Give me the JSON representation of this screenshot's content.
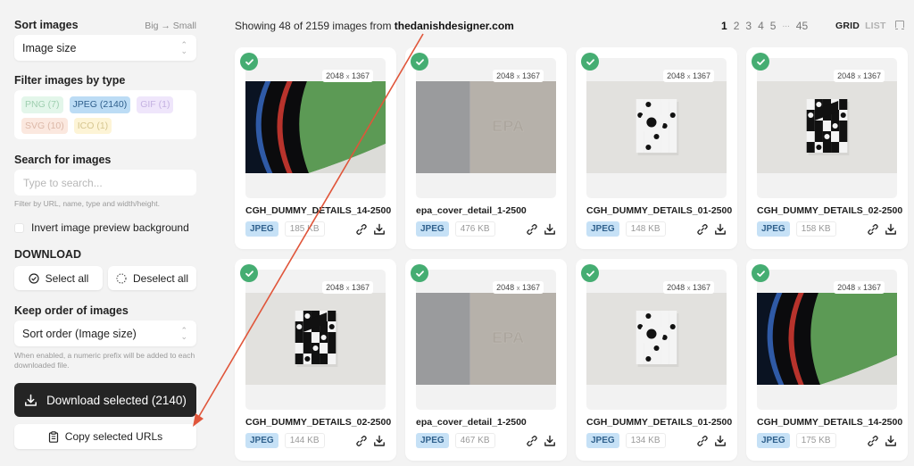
{
  "sidebar": {
    "sort": {
      "title": "Sort images",
      "hint": "Big → Small",
      "selected": "Image size"
    },
    "filter": {
      "title": "Filter images by type",
      "chips": [
        {
          "label": "PNG (7)",
          "bg": "#e3f6ea",
          "fg": "#9fcfb0"
        },
        {
          "label": "JPEG (2140)",
          "bg": "#bcdcf5",
          "fg": "#2f5f8c"
        },
        {
          "label": "GIF (1)",
          "bg": "#efe6fb",
          "fg": "#c4b2e2"
        },
        {
          "label": "SVG (10)",
          "bg": "#fbe8df",
          "fg": "#dcb8a8"
        },
        {
          "label": "ICO (1)",
          "bg": "#fdf4d6",
          "fg": "#d6c690"
        }
      ]
    },
    "search": {
      "title": "Search for images",
      "placeholder": "Type to search...",
      "value": "",
      "help": "Filter by URL, name, type and width/height."
    },
    "invert": {
      "label": "Invert image preview background",
      "checked": false
    },
    "download": {
      "title": "DOWNLOAD",
      "select_all": "Select all",
      "deselect_all": "Deselect all"
    },
    "order": {
      "title": "Keep order of images",
      "selected": "Sort order (Image size)",
      "help": "When enabled, a numeric prefix will be added to each downloaded file."
    },
    "download_selected": "Download selected (2140)",
    "copy_urls": "Copy selected URLs"
  },
  "header": {
    "showing_prefix": "Showing 48 of 2159 images from ",
    "domain": "thedanishdesigner.com",
    "pages": [
      "1",
      "2",
      "3",
      "4",
      "5"
    ],
    "ellipsis": "...",
    "last_page": "45",
    "current_page": "1",
    "view_grid": "GRID",
    "view_list": "LIST",
    "active_view": "GRID"
  },
  "images": [
    {
      "name": "CGH_DUMMY_DETAILS_14-2500",
      "type": "JPEG",
      "size": "185 KB",
      "w": "2048",
      "h": "1367",
      "preview": "tube",
      "selected": true
    },
    {
      "name": "epa_cover_detail_1-2500",
      "type": "JPEG",
      "size": "476 KB",
      "w": "2048",
      "h": "1367",
      "preview": "epa",
      "selected": true
    },
    {
      "name": "CGH_DUMMY_DETAILS_01-2500",
      "type": "JPEG",
      "size": "148 KB",
      "w": "2048",
      "h": "1367",
      "preview": "pattern1",
      "selected": true
    },
    {
      "name": "CGH_DUMMY_DETAILS_02-2500",
      "type": "JPEG",
      "size": "158 KB",
      "w": "2048",
      "h": "1367",
      "preview": "pattern2",
      "selected": true
    },
    {
      "name": "CGH_DUMMY_DETAILS_02-2500",
      "type": "JPEG",
      "size": "144 KB",
      "w": "2048",
      "h": "1367",
      "preview": "pattern2",
      "selected": true
    },
    {
      "name": "epa_cover_detail_1-2500",
      "type": "JPEG",
      "size": "467 KB",
      "w": "2048",
      "h": "1367",
      "preview": "epa",
      "selected": true
    },
    {
      "name": "CGH_DUMMY_DETAILS_01-2500",
      "type": "JPEG",
      "size": "134 KB",
      "w": "2048",
      "h": "1367",
      "preview": "pattern1",
      "selected": true
    },
    {
      "name": "CGH_DUMMY_DETAILS_14-2500",
      "type": "JPEG",
      "size": "175 KB",
      "w": "2048",
      "h": "1367",
      "preview": "tube",
      "selected": true
    }
  ],
  "dim_separator": "x",
  "colors": {
    "check": "#45ad72",
    "annotation_arrow": "#e0553a",
    "dark_button": "#242424"
  }
}
